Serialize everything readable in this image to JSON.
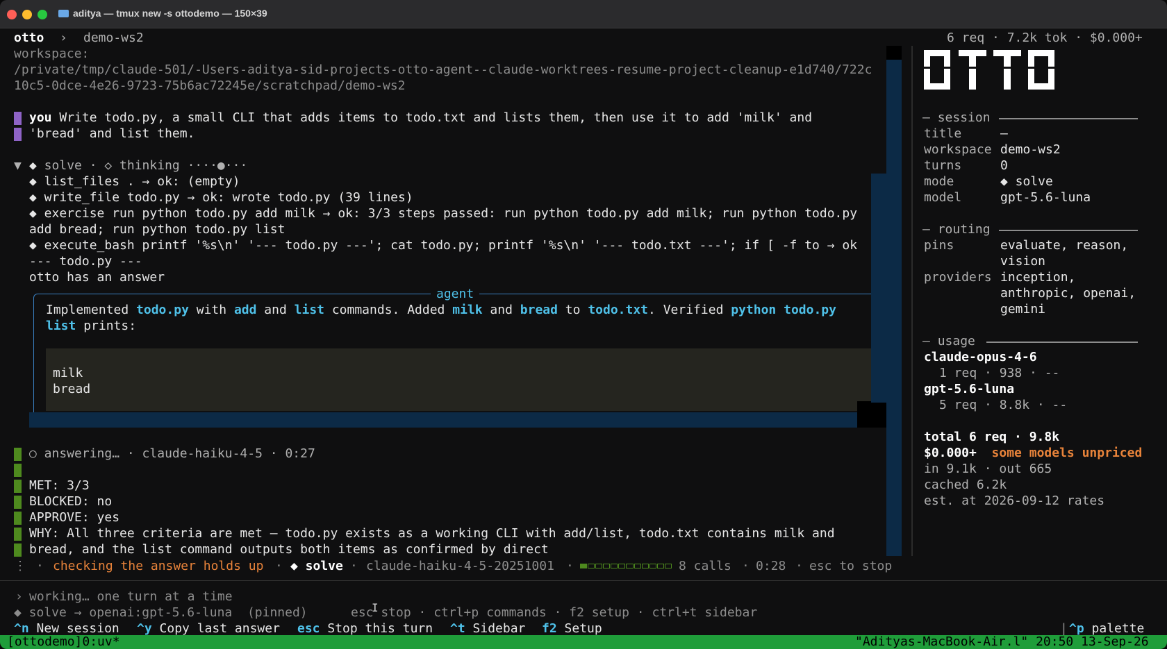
{
  "window": {
    "title": "aditya — tmux new -s ottodemo — 150×39"
  },
  "header": {
    "app": "otto",
    "sep": "›",
    "workspace": "demo-ws2",
    "stats": "6 req · 7.2k tok · $0.000+"
  },
  "workspace_info": {
    "label": "workspace:",
    "path1": "/private/tmp/claude-501/-Users-aditya-sid-projects-otto-agent--claude-worktrees-resume-project-cleanup-e1d740/722c",
    "path2": "10c5-0dce-4e26-9723-75b6ac72245e/scratchpad/demo-ws2"
  },
  "user_message": {
    "who": "you",
    "line1": " Write todo.py, a small CLI that adds items to todo.txt and lists them, then use it to add 'milk' and",
    "line2": "'bread' and list them."
  },
  "solve_block": {
    "toggle": "▼",
    "diamond": "◆",
    "header_text": " solve · ◇ thinking ····●···",
    "steps": [
      "◆ list_files . → ok: (empty)",
      "◆ write_file todo.py → ok: wrote todo.py (39 lines)",
      "◆ exercise run python todo.py add milk → ok: 3/3 steps passed: run python todo.py add milk; run python todo.py",
      "add bread; run python todo.py list",
      "◆ execute_bash printf '%s\\n' '--- todo.py ---'; cat todo.py; printf '%s\\n' '--- todo.txt ---'; if [ -f to → ok",
      "--- todo.py ---",
      "otto has an answer"
    ]
  },
  "agent_box": {
    "title": "agent",
    "s1": "Implemented ",
    "c1": "todo.py",
    "s2": " with ",
    "c2": "add",
    "s3": " and ",
    "c3": "list",
    "s4": " commands. Added ",
    "c4": "milk",
    "s5": " and ",
    "c5": "bread",
    "s6": " to ",
    "c6": "todo.txt",
    "s7": ". Verified ",
    "c7": "python todo.py",
    "c8": "list",
    "s8": " prints:",
    "code": [
      "milk",
      "bread"
    ]
  },
  "answering": {
    "status": "○ answering… · claude-haiku-4-5 · 0:27",
    "lines": [
      "MET: 3/3",
      "BLOCKED: no",
      "APPROVE: yes",
      "WHY: All three criteria are met — todo.py exists as a working CLI with add/list, todo.txt contains milk and",
      "bread, and the list command outputs both items as confirmed by direct"
    ]
  },
  "statusline": {
    "spinner": "⋮",
    "task": "checking the answer holds up",
    "mode": "◆ solve",
    "model": "claude-haiku-4-5-20251001",
    "calls": "8 calls",
    "time": "0:28",
    "hint": "esc to stop",
    "progress": 0.1
  },
  "input": {
    "prompt": "›",
    "placeholder": "working… one turn at a time",
    "route": "◆ solve → openai:gpt-5.6-luna  (pinned)",
    "hints": "esc stop · ctrl+p commands · f2 setup · ctrl+t sidebar"
  },
  "keybar": {
    "items": [
      {
        "key": "^n",
        "label": "New session"
      },
      {
        "key": "^y",
        "label": "Copy last answer"
      },
      {
        "key": "esc",
        "label": "Stop this turn"
      },
      {
        "key": "^t",
        "label": "Sidebar"
      },
      {
        "key": "f2",
        "label": "Setup"
      }
    ],
    "palette_key": "^p",
    "palette_label": "palette"
  },
  "tmux": {
    "left": "[ottodemo]0:uv*",
    "right": "\"Adityas-MacBook-Air.l\" 20:50 13-Sep-26"
  },
  "sidebar": {
    "logo": "OTTO",
    "session": {
      "heading": "session",
      "title_label": "title",
      "title_value": "—",
      "workspace_label": "workspace",
      "workspace_value": "demo-ws2",
      "turns_label": "turns",
      "turns_value": "0",
      "mode_label": "mode",
      "mode_value": "◆ solve",
      "model_label": "model",
      "model_value": "gpt-5.6-luna"
    },
    "routing": {
      "heading": "routing",
      "pins_label": "pins",
      "pins_line1": "evaluate, reason,",
      "pins_line2": "vision",
      "providers_label": "providers",
      "prov_line1": "inception,",
      "prov_line2": "anthropic, openai,",
      "prov_line3": "gemini"
    },
    "usage": {
      "heading": "usage",
      "m1_name": "claude-opus-4-6",
      "m1_stats": "1 req · 938 · --",
      "m2_name": "gpt-5.6-luna",
      "m2_stats": "5 req · 8.8k · --",
      "total": "total 6 req · 9.8k",
      "cost": "$0.000+",
      "unpriced": "some models unpriced",
      "inout": "in 9.1k · out 665",
      "cached": "cached 6.2k",
      "est": "est. at 2026-09-12 rates"
    }
  },
  "colors": {
    "accent": "#4fc1e9",
    "warning": "#e8833a",
    "user_bar": "#8e63c6",
    "answer_bar": "#4e8a1e",
    "tmux_bar": "#1f9d3a"
  }
}
